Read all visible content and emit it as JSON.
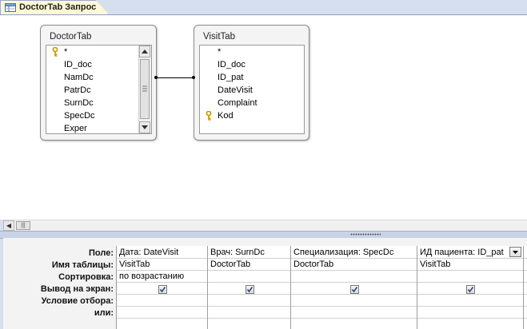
{
  "tab": {
    "title": "DoctorTab Запрос",
    "icon": "query-icon"
  },
  "tables": [
    {
      "name": "DoctorTab",
      "fields": [
        "*",
        "ID_doc",
        "NamDc",
        "PatrDc",
        "SurnDc",
        "SpecDc",
        "Exper"
      ],
      "key_field": "ID_doc"
    },
    {
      "name": "VisitTab",
      "fields": [
        "*",
        "ID_doc",
        "ID_pat",
        "DateVisit",
        "Complaint",
        "Kod"
      ],
      "key_field": "Kod"
    }
  ],
  "grid": {
    "row_labels": [
      "Поле:",
      "Имя таблицы:",
      "Сортировка:",
      "Вывод на экран:",
      "Условие отбора:",
      "или:"
    ],
    "columns": [
      {
        "field": "Дата: DateVisit",
        "table": "VisitTab",
        "sort": "по возрастанию",
        "show": true
      },
      {
        "field": "Врач: SurnDc",
        "table": "DoctorTab",
        "sort": "",
        "show": true
      },
      {
        "field": "Специализация: SpecDc",
        "table": "DoctorTab",
        "sort": "",
        "show": true
      },
      {
        "field": "ИД пациента: ID_pat",
        "table": "VisitTab",
        "sort": "",
        "show": true
      }
    ]
  }
}
